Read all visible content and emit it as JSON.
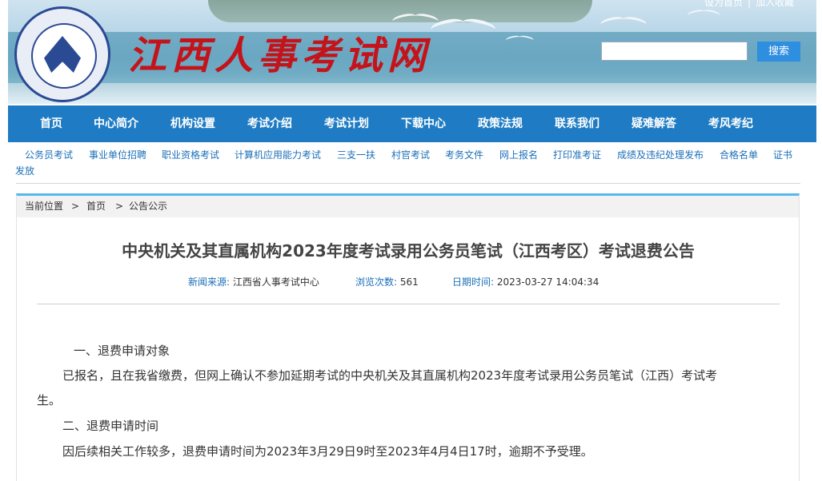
{
  "header": {
    "site_title": "江西人事考试网",
    "top_links": [
      "设为首页",
      "加入收藏"
    ],
    "search": {
      "button": "搜索",
      "value": ""
    }
  },
  "nav": [
    "首页",
    "中心简介",
    "机构设置",
    "考试介绍",
    "考试计划",
    "下载中心",
    "政策法规",
    "联系我们",
    "疑难解答",
    "考风考纪"
  ],
  "subnav": [
    "公务员考试",
    "事业单位招聘",
    "职业资格考试",
    "计算机应用能力考试",
    "三支一扶",
    "村官考试",
    "考务文件",
    "网上报名",
    "打印准考证",
    "成绩及违纪处理发布",
    "合格名单",
    "证书",
    "发放"
  ],
  "breadcrumb": {
    "label": "当前位置",
    "items": [
      "首页",
      "公告公示"
    ],
    "sep": ">"
  },
  "article": {
    "title": "中央机关及其直属机构2023年度考试录用公务员笔试（江西考区）考试退费公告",
    "source_label": "新闻来源:",
    "source": "江西省人事考试中心",
    "views_label": "浏览次数:",
    "views": "561",
    "date_label": "日期时间:",
    "date": "2023-03-27 14:04:34",
    "paragraphs": [
      "一、退费申请对象",
      "已报名，且在我省缴费，但网上确认不参加延期考试的中央机关及其直属机构2023年度考试录用公务员笔试（江西）考试考",
      "生。",
      "二、退费申请时间",
      "因后续相关工作较多，退费申请时间为2023年3月29日9时至2023年4月4日17时，逾期不予受理。"
    ]
  }
}
